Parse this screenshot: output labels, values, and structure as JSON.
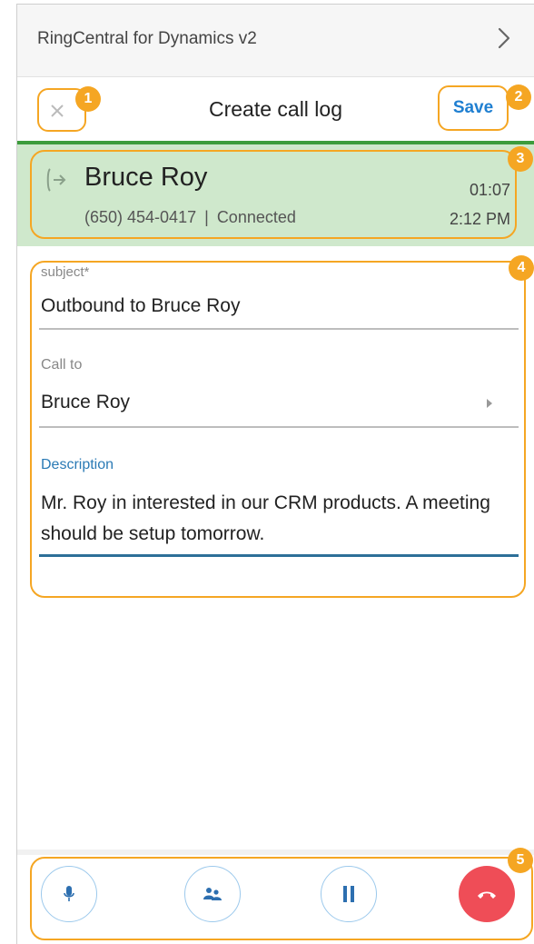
{
  "app": {
    "title": "RingCentral for Dynamics v2"
  },
  "header": {
    "title": "Create call log",
    "close_label": "×",
    "save_label": "Save"
  },
  "call": {
    "name": "Bruce Roy",
    "phone": "(650) 454-0417",
    "separator": "|",
    "status": "Connected",
    "duration": "01:07",
    "time": "2:12 PM",
    "direction_icon": "outbound-call-icon"
  },
  "form": {
    "subject_label": "subject*",
    "subject_value": "Outbound to Bruce Roy",
    "call_to_label": "Call to",
    "call_to_value": "Bruce Roy",
    "description_label": "Description",
    "description_value": "Mr. Roy in interested in our CRM products. A meeting should be setup tomorrow."
  },
  "controls": [
    {
      "name": "mute",
      "icon": "microphone-icon"
    },
    {
      "name": "transfer",
      "icon": "transfer-icon"
    },
    {
      "name": "hold",
      "icon": "pause-icon"
    },
    {
      "name": "hangup",
      "icon": "hangup-icon"
    }
  ],
  "annotations": [
    "1",
    "2",
    "3",
    "4",
    "5"
  ],
  "colors": {
    "annotation": "#f5a623",
    "accent_blue": "#1f7fd1",
    "call_bg": "#cfe8cc",
    "connected_green": "#3c9c3c",
    "hangup_red": "#ef4d57"
  }
}
